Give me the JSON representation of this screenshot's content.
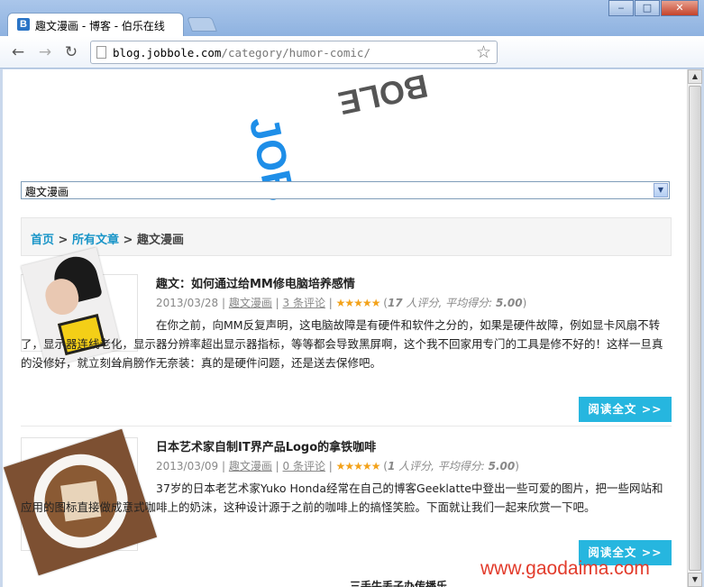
{
  "browser": {
    "tab_title": "趣文漫画 - 博客 - 伯乐在线",
    "tab_favicon": "B",
    "url_host": "blog.jobbole.com",
    "url_path": "/category/humor-comic/",
    "minimize": "‒",
    "maximize": "□",
    "close": "✕"
  },
  "page": {
    "category_selected": "趣文漫画",
    "breadcrumb": {
      "home": "首页",
      "sep1": " > ",
      "all_articles": "所有文章",
      "sep2": " > ",
      "current": "趣文漫画"
    },
    "read_more": "阅读全文 >>"
  },
  "posts": [
    {
      "title": "趣文：如何通过给MM修电脑培养感情",
      "date": "2013/03/28",
      "category": "趣文漫画",
      "comments": "3 条评论",
      "stars": "★★★★★",
      "rating_count": "17",
      "rating_label": " 人评分, 平均得分: ",
      "rating_avg": "5.00",
      "excerpt": "在你之前，向MM反复声明，这电脑故障是有硬件和软件之分的，如果是硬件故障，例如显卡风扇不转了，显示器连线老化，显示器分辨率超出显示器指标，等等都会导致黑屏啊，这个我不回家用专门的工具是修不好的！这样一旦真的没修好，就立刻耸肩膀作无奈装：真的是硬件问题，还是送去保修吧。"
    },
    {
      "title": "日本艺术家自制IT界产品Logo的拿铁咖啡",
      "date": "2013/03/09",
      "category": "趣文漫画",
      "comments": "0 条评论",
      "stars": "★★★★★",
      "rating_count": "1",
      "rating_label": " 人评分, 平均得分: ",
      "rating_avg": "5.00",
      "excerpt": "37岁的日本老艺术家Yuko Honda经常在自己的博客Geeklatte中登出一些可爱的图片，把一些网站和应用的图标直接做成意式咖啡上的奶沫，这种设计源于之前的咖啡上的搞怪笑脸。下面就让我们一起来欣赏一下吧。"
    }
  ],
  "watermark": "www.gaodaima.com",
  "cut_off_text": "三手牛丢子办传播乐"
}
